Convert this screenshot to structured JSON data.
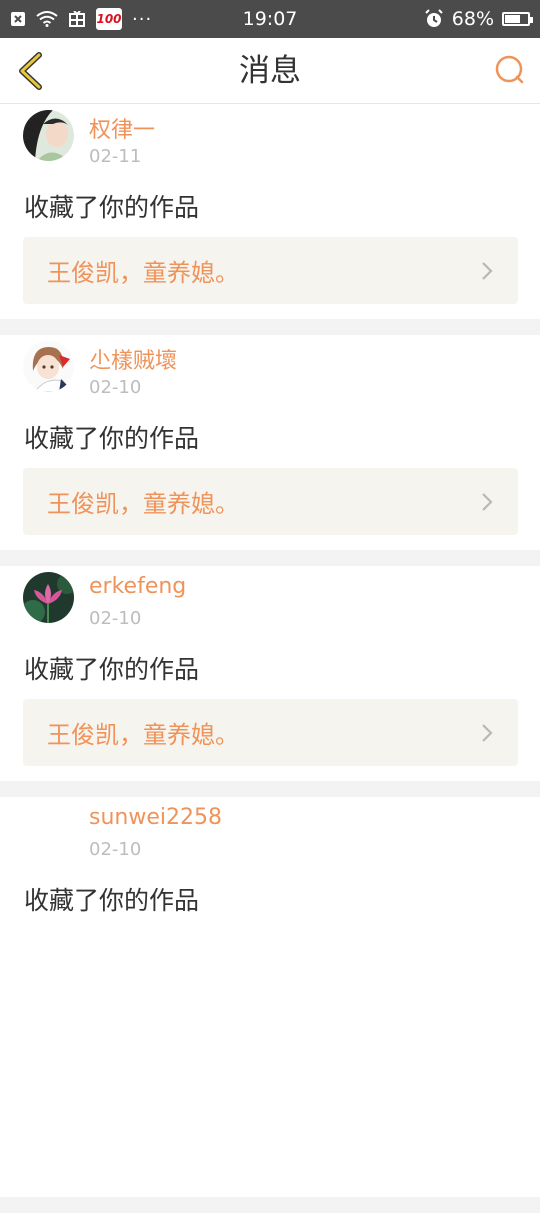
{
  "status_bar": {
    "time": "19:07",
    "battery_text": "68%",
    "battery_level": 0.68,
    "badge_text": "100",
    "more_text": "···",
    "icons": [
      "close-box-icon",
      "wifi-icon",
      "phone-grid-icon",
      "alarm-icon",
      "battery-icon"
    ]
  },
  "nav": {
    "title": "消息",
    "back_icon": "chevron-left-icon",
    "search_icon": "search-icon",
    "accent": "#f0935a"
  },
  "messages": [
    {
      "user": "权律一",
      "date": "02-11",
      "action": "收藏了你的作品",
      "work": "王俊凯，童养媳。"
    },
    {
      "user": "尐樣贼壞",
      "date": "02-10",
      "action": "收藏了你的作品",
      "work": "王俊凯，童养媳。"
    },
    {
      "user": "erkefeng",
      "date": "02-10",
      "action": "收藏了你的作品",
      "work": "王俊凯，童养媳。"
    },
    {
      "user": "sunwei2258",
      "date": "02-10",
      "action": "收藏了你的作品",
      "work": ""
    }
  ]
}
